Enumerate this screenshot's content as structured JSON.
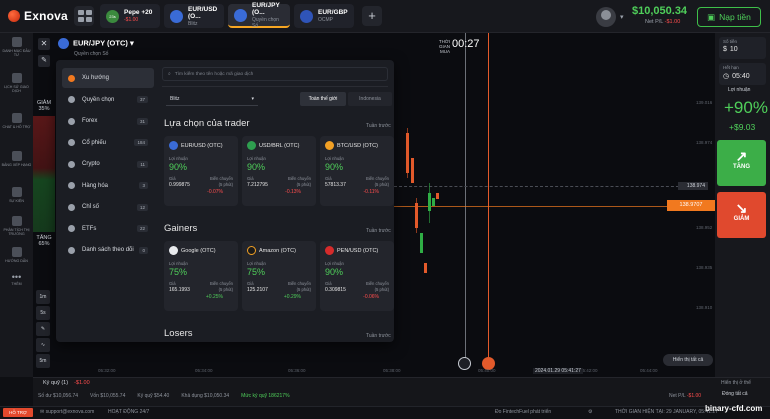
{
  "app": {
    "name": "Exnova"
  },
  "tabs": [
    {
      "title": "Pepe +20",
      "sub": "-$1.00",
      "badge": "23s",
      "icon_color": "#3b8a3e",
      "sub_neg": true
    },
    {
      "title": "EUR/USD (O...",
      "sub": "Blitz",
      "icon_color": "#3a6bd6"
    },
    {
      "title": "EUR/JPY (O...",
      "sub": "Quyền chọn Số",
      "icon_color": "#3a6bd6",
      "active": true
    },
    {
      "title": "EUR/GBP",
      "sub": "OCMP",
      "icon_color": "#2f54b8"
    }
  ],
  "header": {
    "balance": "$10,050.34",
    "netpl_label": "Net P/L",
    "netpl_value": "-$1.00",
    "deposit_label": "Nạp tiền"
  },
  "leftnav": [
    {
      "label": "DANH MỤC ĐẦU TƯ",
      "icon": "portfolio-icon"
    },
    {
      "label": "LỊCH SỬ GIAO DỊCH",
      "icon": "history-icon"
    },
    {
      "label": "CHAT & HỖ TRỢ",
      "icon": "chat-icon"
    },
    {
      "label": "BẢNG XẾP HẠNG",
      "icon": "leaderboard-icon"
    },
    {
      "label": "SỰ KIỆN",
      "icon": "events-icon"
    },
    {
      "label": "PHÂN TÍCH THỊ TRƯỜNG",
      "icon": "analysis-icon"
    },
    {
      "label": "HƯỚNG DẪN",
      "icon": "tutorial-icon"
    },
    {
      "label": "THÊM",
      "icon": "more-icon"
    }
  ],
  "sentiment": {
    "down_label": "GIẢM",
    "down_pct": "35%",
    "up_label": "TĂNG",
    "up_pct": "65%"
  },
  "tools": [
    "1m",
    "5s",
    "✎",
    "∿",
    "5m"
  ],
  "asset": {
    "name": "EUR/JPY (OTC)",
    "type": "Quyền chọn Số"
  },
  "picker": {
    "search_placeholder": "Tìm kiếm theo tên hoặc mã giao dịch",
    "filter_value": "Blitz",
    "seg_on": "Toàn thế giới",
    "seg_off": "Indonesia",
    "categories": [
      {
        "name": "Xu hướng",
        "count": ""
      },
      {
        "name": "Quyền chọn",
        "count": "37"
      },
      {
        "name": "Forex",
        "count": "31"
      },
      {
        "name": "Cổ phiếu",
        "count": "184"
      },
      {
        "name": "Crypto",
        "count": "11"
      },
      {
        "name": "Hàng hóa",
        "count": "3"
      },
      {
        "name": "Chỉ số",
        "count": "12"
      },
      {
        "name": "ETFs",
        "count": "22"
      },
      {
        "name": "Danh sách theo dõi",
        "count": "0"
      }
    ],
    "sections": [
      {
        "title": "Lựa chọn của trader",
        "more": "Tuần trước",
        "cards": [
          {
            "name": "EUR/USD (OTC)",
            "icon_color": "#3a6bd6",
            "pct": "90%",
            "price": "0.999875",
            "chg": "-0.07%",
            "neg": true
          },
          {
            "name": "USD/BRL (OTC)",
            "icon_color": "#2e9e4f",
            "pct": "90%",
            "price": "7.212795",
            "chg": "-0.13%",
            "neg": true
          },
          {
            "name": "BTC/USD (OTC)",
            "icon_color": "#f2a024",
            "pct": "90%",
            "price": "57813.37",
            "chg": "-0.11%",
            "neg": true
          }
        ]
      },
      {
        "title": "Gainers",
        "more": "Tuần trước",
        "cards": [
          {
            "name": "Google (OTC)",
            "icon_color": "#e8eaed",
            "pct": "75%",
            "price": "165.1993",
            "chg": "+0.25%",
            "neg": false
          },
          {
            "name": "Amazon (OTC)",
            "icon_color": "#1c1c1c",
            "pct": "75%",
            "price": "125.2107",
            "chg": "+0.29%",
            "neg": false
          },
          {
            "name": "PEN/USD (OTC)",
            "icon_color": "#d62b2b",
            "pct": "90%",
            "price": "0.309815",
            "chg": "-0.06%",
            "neg": true
          }
        ]
      },
      {
        "title": "Losers",
        "more": "Tuần trước",
        "cards": []
      }
    ],
    "labels": {
      "profit": "Lợi nhuận",
      "price": "Giá",
      "change": "Biến chuyển",
      "period": "(5 phút)"
    }
  },
  "chart": {
    "time_left_label": "THỜI GIAN MUA",
    "timer": "00:27",
    "current_price": "138.9707",
    "ref_price": "138.974",
    "yticks": [
      "139.016",
      "138.974",
      "138.952",
      "138.935",
      "138.910"
    ],
    "xticks": [
      "05:32:00",
      "05:34:00",
      "05:36:00",
      "05:38:00",
      "05:40:00",
      "05:42:00",
      "05:44:00"
    ],
    "date_label": "2024.01.29 05:41:27",
    "show_all": "Hiển thị tất cả"
  },
  "rightpanel": {
    "amount_label": "Số tiền",
    "amount": "10",
    "time_label": "Hết hạn",
    "time": "05:40",
    "profit_label": "Lợi nhuận",
    "profit_pct": "+90%",
    "profit_amt": "+$9.03",
    "up_label": "TĂNG",
    "down_label": "GIẢM"
  },
  "bottombar": {
    "margin_label": "Ký quỹ (1)",
    "margin_value": "-$1.00",
    "balance": "Số dư $10,056.74",
    "equity": "Vốn $10,055.74",
    "margin": "Ký quỹ $54.40",
    "available": "Khả dụng $10,050.34",
    "level": "Mức ký quỹ 186217%",
    "show_right": "Hiển thị ở thể",
    "netpl_label": "Net P/L",
    "netpl_value": "-$1.00",
    "close_all": "Đóng tất cả"
  },
  "statusbar": {
    "help": "HỖ TRỢ",
    "email": "support@exnova.com",
    "hours": "HOẠT ĐỘNG 24/7",
    "tagline": "Đo FintechFuel phát triển",
    "time": "THỜI GIAN HIỆN TẠI: 29 JANUARY, 05:41:27",
    "watermark": "binary-cfd.com"
  }
}
